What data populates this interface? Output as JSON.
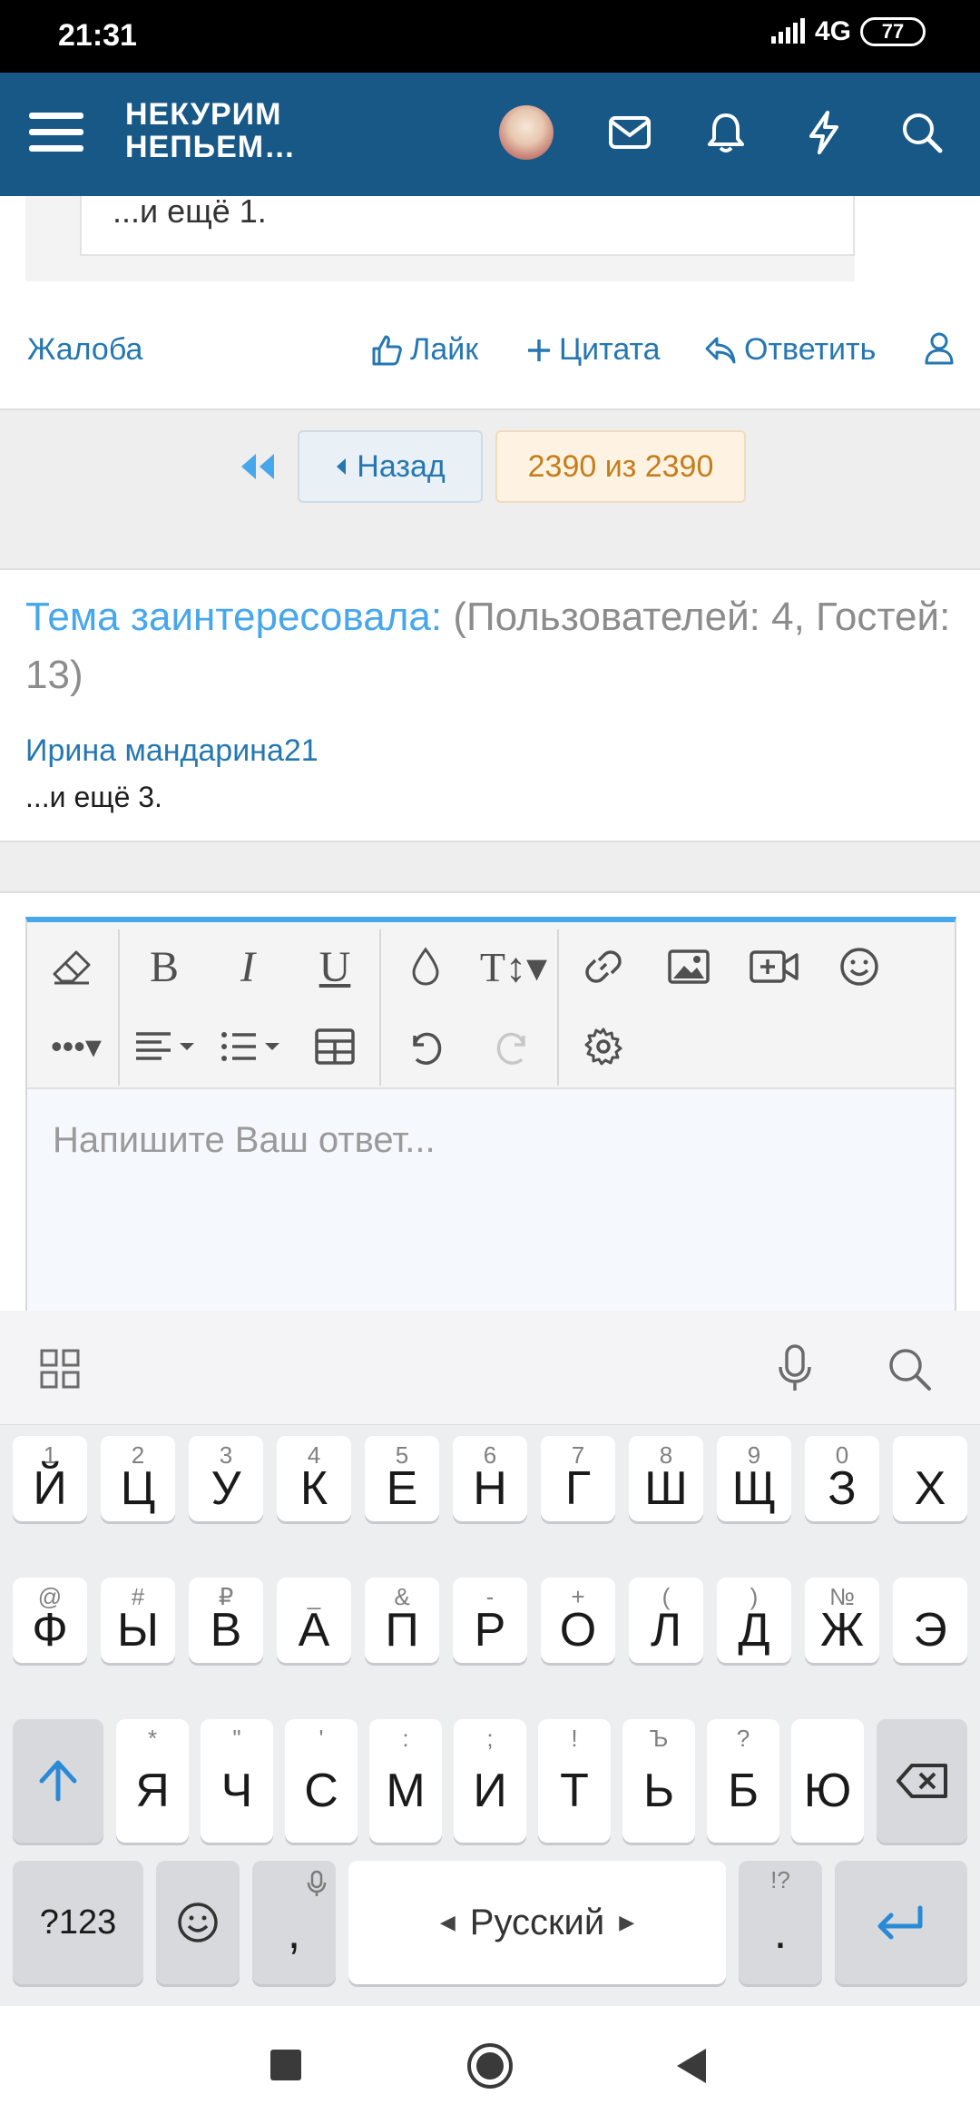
{
  "status_bar": {
    "time": "21:31",
    "network": "4G",
    "battery": "77"
  },
  "header": {
    "logo_line1": "НЕКУРИМ",
    "logo_line2": "НЕПЬЕМ…"
  },
  "previous_post": {
    "quote_more": "...и ещё 1."
  },
  "post_actions": {
    "report": "Жалоба",
    "like": "Лайк",
    "quote": "Цитата",
    "reply": "Ответить"
  },
  "pagination": {
    "back_label": "Назад",
    "current": "2390 из 2390"
  },
  "viewers": {
    "title_lead": "Тема заинтересовала:",
    "title_counts": "(Пользователей: 4, Гостей: 13)",
    "user": "Ирина мандарина21",
    "more": "...и ещё 3."
  },
  "editor": {
    "placeholder": "Напишите Ваш ответ..."
  },
  "keyboard": {
    "row1": [
      {
        "hint": "1",
        "key": "Й"
      },
      {
        "hint": "2",
        "key": "Ц"
      },
      {
        "hint": "3",
        "key": "У"
      },
      {
        "hint": "4",
        "key": "К"
      },
      {
        "hint": "5",
        "key": "Е"
      },
      {
        "hint": "6",
        "key": "Н"
      },
      {
        "hint": "7",
        "key": "Г"
      },
      {
        "hint": "8",
        "key": "Ш"
      },
      {
        "hint": "9",
        "key": "Щ"
      },
      {
        "hint": "0",
        "key": "З"
      },
      {
        "hint": "",
        "key": "Х"
      }
    ],
    "row2": [
      {
        "hint": "@",
        "key": "Ф"
      },
      {
        "hint": "#",
        "key": "Ы"
      },
      {
        "hint": "₽",
        "key": "В"
      },
      {
        "hint": "_",
        "key": "А"
      },
      {
        "hint": "&",
        "key": "П"
      },
      {
        "hint": "-",
        "key": "Р"
      },
      {
        "hint": "+",
        "key": "О"
      },
      {
        "hint": "(",
        "key": "Л"
      },
      {
        "hint": ")",
        "key": "Д"
      },
      {
        "hint": "№",
        "key": "Ж"
      },
      {
        "hint": "",
        "key": "Э"
      }
    ],
    "row3": [
      {
        "hint": "*",
        "key": "Я"
      },
      {
        "hint": "\"",
        "key": "Ч"
      },
      {
        "hint": "'",
        "key": "С"
      },
      {
        "hint": ":",
        "key": "М"
      },
      {
        "hint": ";",
        "key": "И"
      },
      {
        "hint": "!",
        "key": "Т"
      },
      {
        "hint": "Ъ",
        "key": "Ь"
      },
      {
        "hint": "?",
        "key": "Б"
      },
      {
        "hint": "",
        "key": "Ю"
      }
    ],
    "symbols_label": "?123",
    "comma": ",",
    "space_label": "Русский",
    "period": ".",
    "period_hint": "!?"
  }
}
